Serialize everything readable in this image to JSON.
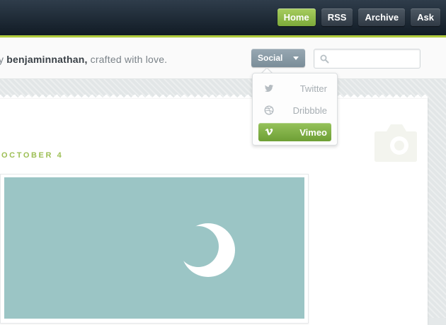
{
  "nav": {
    "items": [
      {
        "label": "Home",
        "active": true
      },
      {
        "label": "RSS",
        "active": false
      },
      {
        "label": "Archive",
        "active": false
      },
      {
        "label": "Ask",
        "active": false
      }
    ]
  },
  "header": {
    "tagline_prefix": "y",
    "author": "benjaminnathan,",
    "tagline_suffix": "crafted with love."
  },
  "social": {
    "label": "Social",
    "items": [
      {
        "label": "Twitter",
        "icon": "twitter-icon",
        "selected": false
      },
      {
        "label": "Dribbble",
        "icon": "dribbble-icon",
        "selected": false
      },
      {
        "label": "Vimeo",
        "icon": "vimeo-icon",
        "selected": true
      }
    ]
  },
  "search": {
    "placeholder": "",
    "value": ""
  },
  "post": {
    "date": "OCTOBER 4"
  },
  "colors": {
    "accent_green": "#8ab94a",
    "photo_bg": "#9bc5c5",
    "nav_dark": "#1c2631"
  }
}
